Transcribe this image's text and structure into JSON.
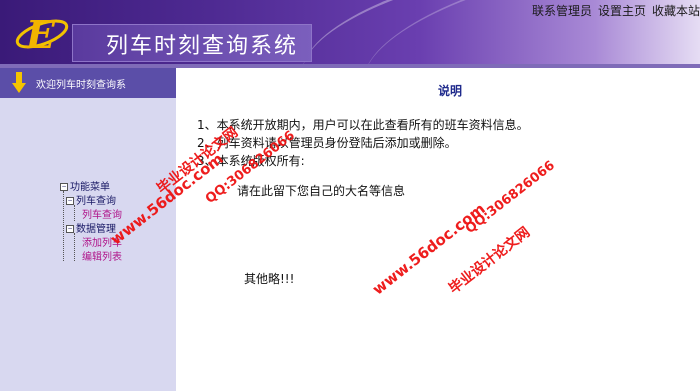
{
  "app": {
    "title": "列车时刻查询系统",
    "logo_letter": "E"
  },
  "toplinks": [
    "联系管理员",
    "设置主页",
    "收藏本站"
  ],
  "sidebar": {
    "header": "欢迎列车时刻查询系",
    "tree": {
      "root": "功能菜单",
      "groups": [
        {
          "label": "列车查询",
          "items": [
            "列车查询"
          ]
        },
        {
          "label": "数据管理",
          "items": [
            "添加列车",
            "编辑列表"
          ]
        }
      ]
    }
  },
  "main": {
    "heading": "说明",
    "lines": [
      "1、本系统开放期内，用户可以在此查看所有的班车资料信息。",
      "2、列车资料请以管理员身份登陆后添加或删除。",
      "3、本系统版权所有:",
      "请在此留下您自己的大名等信息",
      "其他略!!!"
    ]
  },
  "watermarks": [
    "毕业设计论文网",
    "www.56doc.com",
    "QQ:306826066"
  ],
  "colors": {
    "header_dark": "#3a1a78",
    "sidebar_bg": "#d8d8f0",
    "heading": "#1f2a8c",
    "watermark": "#ee1111",
    "tree_leaf": "#b0158a"
  }
}
